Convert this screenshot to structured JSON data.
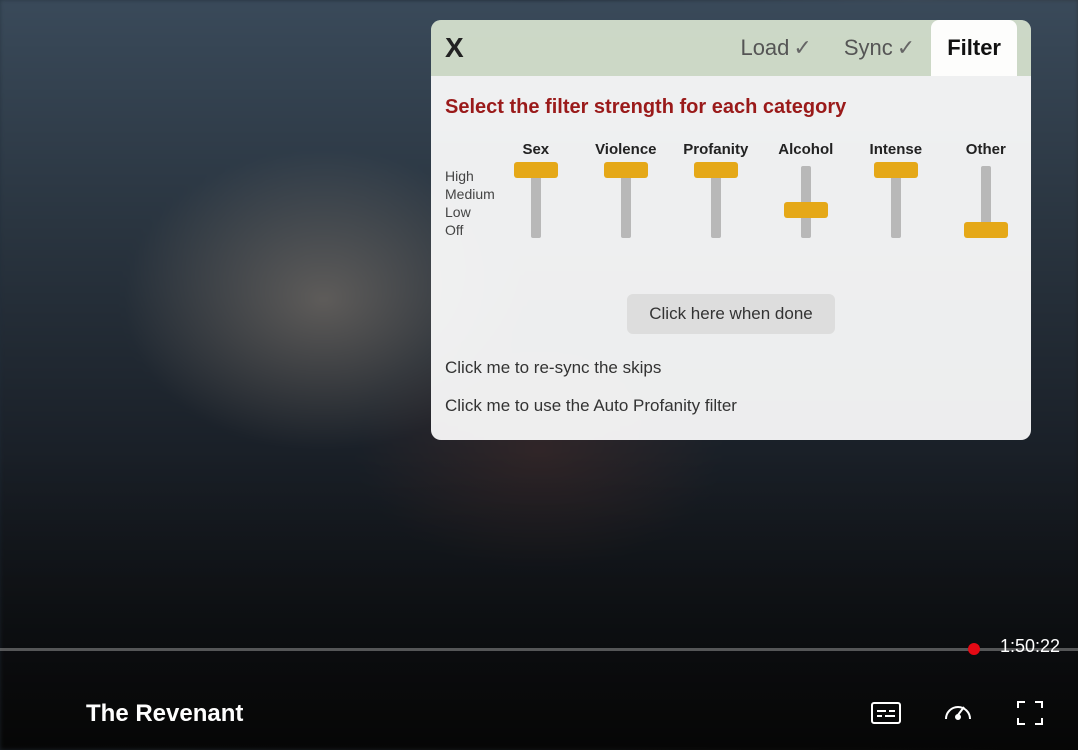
{
  "panel": {
    "close": "X",
    "tabs": {
      "load": "Load",
      "sync": "Sync",
      "filter": "Filter",
      "check": "✓"
    },
    "title": "Select the filter strength for each category",
    "levels": {
      "high": "High",
      "medium": "Medium",
      "low": "Low",
      "off": "Off"
    },
    "sliders": [
      {
        "label": "Sex",
        "value": "high"
      },
      {
        "label": "Violence",
        "value": "high"
      },
      {
        "label": "Profanity",
        "value": "high"
      },
      {
        "label": "Alcohol",
        "value": "low"
      },
      {
        "label": "Intense",
        "value": "high"
      },
      {
        "label": "Other",
        "value": "off"
      }
    ],
    "done_button": "Click here when done",
    "resync_link": "Click me to re-sync the skips",
    "profanity_link": "Click me to use the Auto Profanity filter"
  },
  "player": {
    "title": "The Revenant",
    "time": "1:50:22"
  }
}
